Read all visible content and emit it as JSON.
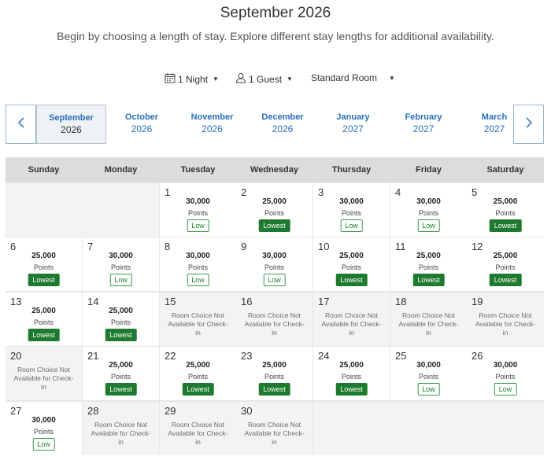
{
  "header": {
    "title": "September 2026",
    "subtitle": "Begin by choosing a length of stay. Explore different stay lengths for additional availability."
  },
  "filters": {
    "nights": "1 Night",
    "guests": "1 Guest",
    "room": "Standard Room"
  },
  "months": [
    {
      "name": "September",
      "year": "2026"
    },
    {
      "name": "October",
      "year": "2026"
    },
    {
      "name": "November",
      "year": "2026"
    },
    {
      "name": "December",
      "year": "2026"
    },
    {
      "name": "January",
      "year": "2027"
    },
    {
      "name": "February",
      "year": "2027"
    },
    {
      "name": "March",
      "year": "2027"
    }
  ],
  "selected_month_index": 0,
  "weekdays": [
    "Sunday",
    "Monday",
    "Tuesday",
    "Wednesday",
    "Thursday",
    "Friday",
    "Saturday"
  ],
  "points_label": "Points",
  "unavailable_text": "Room Choice Not Available for Check-in",
  "first_weekday_index": 2,
  "days": [
    {
      "day": "1",
      "points": "30,000",
      "badge": "Low"
    },
    {
      "day": "2",
      "points": "25,000",
      "badge": "Lowest"
    },
    {
      "day": "3",
      "points": "30,000",
      "badge": "Low"
    },
    {
      "day": "4",
      "points": "30,000",
      "badge": "Low"
    },
    {
      "day": "5",
      "points": "25,000",
      "badge": "Lowest"
    },
    {
      "day": "6",
      "points": "25,000",
      "badge": "Lowest"
    },
    {
      "day": "7",
      "points": "30,000",
      "badge": "Low"
    },
    {
      "day": "8",
      "points": "30,000",
      "badge": "Low"
    },
    {
      "day": "9",
      "points": "30,000",
      "badge": "Low"
    },
    {
      "day": "10",
      "points": "25,000",
      "badge": "Lowest"
    },
    {
      "day": "11",
      "points": "25,000",
      "badge": "Lowest"
    },
    {
      "day": "12",
      "points": "25,000",
      "badge": "Lowest"
    },
    {
      "day": "13",
      "points": "25,000",
      "badge": "Lowest"
    },
    {
      "day": "14",
      "points": "25,000",
      "badge": "Lowest"
    },
    {
      "day": "15",
      "unavailable": true
    },
    {
      "day": "16",
      "unavailable": true
    },
    {
      "day": "17",
      "unavailable": true
    },
    {
      "day": "18",
      "unavailable": true
    },
    {
      "day": "19",
      "unavailable": true
    },
    {
      "day": "20",
      "unavailable": true
    },
    {
      "day": "21",
      "points": "25,000",
      "badge": "Lowest"
    },
    {
      "day": "22",
      "points": "25,000",
      "badge": "Lowest"
    },
    {
      "day": "23",
      "points": "25,000",
      "badge": "Lowest"
    },
    {
      "day": "24",
      "points": "25,000",
      "badge": "Lowest"
    },
    {
      "day": "25",
      "points": "30,000",
      "badge": "Low"
    },
    {
      "day": "26",
      "points": "30,000",
      "badge": "Low"
    },
    {
      "day": "27",
      "points": "30,000",
      "badge": "Low"
    },
    {
      "day": "28",
      "unavailable": true
    },
    {
      "day": "29",
      "unavailable": true
    },
    {
      "day": "30",
      "unavailable": true
    }
  ],
  "icons": {
    "calendar": "calendar-icon",
    "guest": "person-icon",
    "prev": "chevron-left-icon",
    "next": "chevron-right-icon"
  },
  "colors": {
    "accent_blue": "#2a6ebb",
    "lowest_green": "#1e7a2e",
    "low_border": "#3a9a4a"
  }
}
